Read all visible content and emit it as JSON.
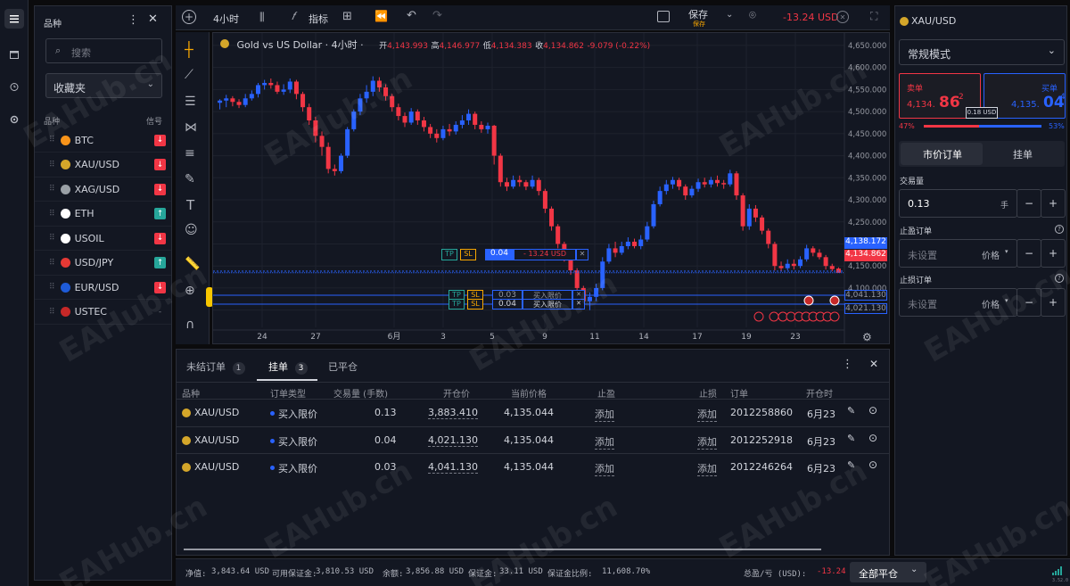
{
  "left_rail": {
    "icons": [
      "list-icon",
      "calendar-icon",
      "alarm-icon",
      "settings-icon"
    ]
  },
  "watchlist": {
    "title": "品种",
    "search_placeholder": "搜索",
    "group": "收藏夹",
    "col_symbol": "品种",
    "col_signal": "信号",
    "items": [
      {
        "name": "BTC",
        "signal": "down",
        "coin_color": "#f7931a"
      },
      {
        "name": "XAU/USD",
        "signal": "down",
        "coin_color": "#d4a62a"
      },
      {
        "name": "XAG/USD",
        "signal": "down",
        "coin_color": "#9aa0a6"
      },
      {
        "name": "ETH",
        "signal": "up",
        "coin_color": "#ffffff"
      },
      {
        "name": "USOIL",
        "signal": "down",
        "coin_color": "#ffffff"
      },
      {
        "name": "USD/JPY",
        "signal": "up",
        "coin_color": "#e53935"
      },
      {
        "name": "EUR/USD",
        "signal": "down",
        "coin_color": "#1e5bd8"
      },
      {
        "name": "USTEC",
        "signal": "none",
        "coin_color": "#c62828"
      }
    ]
  },
  "toolbar": {
    "timeframe": "4小时",
    "indicators": "指标",
    "save": "保存",
    "save_sub": "保存",
    "pnl": "-13.24 USD"
  },
  "chart_header": {
    "symbol": "Gold vs US Dollar · 4小时 ·",
    "open_label": "开",
    "open": "4,143.993",
    "high_label": "高",
    "high": "4,146.977",
    "low_label": "低",
    "low": "4,134.383",
    "close_label": "收",
    "close": "4,134.862",
    "change": "-9.079 (-0.22%)"
  },
  "chart_data": {
    "type": "candlestick",
    "ylim": [
      4021,
      4662
    ],
    "y_ticks": [
      "4,650.000",
      "4,600.000",
      "4,550.000",
      "4,500.000",
      "4,450.000",
      "4,400.000",
      "4,350.000",
      "4,300.000",
      "4,250.000",
      "4,200.000",
      "4,150.000",
      "4,100.000",
      "4,050.000"
    ],
    "x_ticks": [
      "24",
      "27",
      "6月",
      "3",
      "5",
      "9",
      "11",
      "14",
      "17",
      "19",
      "23"
    ],
    "candles": [
      [
        4520,
        4525,
        4512,
        4528,
        4505
      ],
      [
        4525,
        4530,
        4518,
        4538,
        4510
      ],
      [
        4530,
        4522,
        4525,
        4535,
        4512
      ],
      [
        4522,
        4515,
        4520,
        4528,
        4508
      ],
      [
        4515,
        4530,
        4518,
        4540,
        4510
      ],
      [
        4530,
        4540,
        4535,
        4548,
        4525
      ],
      [
        4540,
        4560,
        4555,
        4565,
        4532
      ],
      [
        4560,
        4565,
        4558,
        4572,
        4550
      ],
      [
        4565,
        4560,
        4563,
        4575,
        4552
      ],
      [
        4560,
        4545,
        4550,
        4568,
        4540
      ],
      [
        4545,
        4550,
        4548,
        4562,
        4538
      ],
      [
        4550,
        4568,
        4560,
        4575,
        4542
      ],
      [
        4568,
        4540,
        4545,
        4572,
        4528
      ],
      [
        4540,
        4510,
        4515,
        4545,
        4500
      ],
      [
        4510,
        4480,
        4485,
        4518,
        4470
      ],
      [
        4480,
        4445,
        4450,
        4488,
        4430
      ],
      [
        4445,
        4420,
        4428,
        4455,
        4400
      ],
      [
        4420,
        4370,
        4378,
        4430,
        4360
      ],
      [
        4370,
        4365,
        4368,
        4380,
        4355
      ],
      [
        4365,
        4400,
        4395,
        4405,
        4360
      ],
      [
        4400,
        4460,
        4455,
        4465,
        4395
      ],
      [
        4460,
        4500,
        4495,
        4505,
        4455
      ],
      [
        4500,
        4530,
        4520,
        4540,
        4492
      ],
      [
        4530,
        4545,
        4540,
        4560,
        4520
      ],
      [
        4545,
        4570,
        4565,
        4580,
        4535
      ],
      [
        4570,
        4555,
        4560,
        4578,
        4545
      ],
      [
        4555,
        4535,
        4540,
        4562,
        4525
      ],
      [
        4535,
        4510,
        4515,
        4540,
        4500
      ],
      [
        4510,
        4490,
        4495,
        4518,
        4480
      ],
      [
        4490,
        4475,
        4478,
        4498,
        4465
      ],
      [
        4475,
        4500,
        4495,
        4508,
        4470
      ],
      [
        4500,
        4480,
        4485,
        4505,
        4470
      ],
      [
        4480,
        4465,
        4468,
        4488,
        4455
      ],
      [
        4465,
        4450,
        4455,
        4472,
        4440
      ],
      [
        4450,
        4440,
        4445,
        4460,
        4430
      ],
      [
        4440,
        4460,
        4455,
        4468,
        4435
      ],
      [
        4460,
        4455,
        4458,
        4472,
        4445
      ],
      [
        4455,
        4470,
        4465,
        4478,
        4448
      ],
      [
        4470,
        4480,
        4475,
        4492,
        4462
      ],
      [
        4480,
        4495,
        4490,
        4505,
        4470
      ],
      [
        4495,
        4470,
        4475,
        4500,
        4460
      ],
      [
        4470,
        4460,
        4465,
        4478,
        4452
      ],
      [
        4460,
        4468,
        4463,
        4475,
        4450
      ],
      [
        4468,
        4400,
        4405,
        4470,
        4380
      ],
      [
        4400,
        4340,
        4345,
        4405,
        4330
      ],
      [
        4340,
        4330,
        4335,
        4350,
        4320
      ],
      [
        4330,
        4345,
        4340,
        4355,
        4325
      ],
      [
        4345,
        4340,
        4343,
        4355,
        4330
      ],
      [
        4340,
        4330,
        4335,
        4345,
        4322
      ],
      [
        4330,
        4345,
        4340,
        4355,
        4325
      ],
      [
        4345,
        4320,
        4325,
        4350,
        4310
      ],
      [
        4320,
        4280,
        4285,
        4325,
        4270
      ],
      [
        4280,
        4240,
        4245,
        4285,
        4230
      ],
      [
        4240,
        4200,
        4205,
        4245,
        4190
      ],
      [
        4200,
        4170,
        4175,
        4205,
        4160
      ],
      [
        4170,
        4140,
        4145,
        4175,
        4130
      ],
      [
        4140,
        4100,
        4105,
        4145,
        4090
      ],
      [
        4100,
        4070,
        4075,
        4105,
        4060
      ],
      [
        4070,
        4080,
        4078,
        4090,
        4050
      ],
      [
        4080,
        4100,
        4095,
        4110,
        4070
      ],
      [
        4100,
        4160,
        4150,
        4170,
        4095
      ],
      [
        4160,
        4190,
        4185,
        4200,
        4155
      ],
      [
        4190,
        4180,
        4185,
        4205,
        4170
      ],
      [
        4180,
        4195,
        4190,
        4205,
        4175
      ],
      [
        4195,
        4205,
        4200,
        4215,
        4188
      ],
      [
        4205,
        4195,
        4198,
        4212,
        4190
      ],
      [
        4195,
        4210,
        4205,
        4220,
        4188
      ],
      [
        4210,
        4240,
        4235,
        4250,
        4205
      ],
      [
        4240,
        4290,
        4285,
        4298,
        4235
      ],
      [
        4290,
        4320,
        4315,
        4330,
        4285
      ],
      [
        4320,
        4335,
        4330,
        4345,
        4312
      ],
      [
        4335,
        4345,
        4340,
        4352,
        4325
      ],
      [
        4345,
        4330,
        4335,
        4350,
        4322
      ],
      [
        4330,
        4310,
        4315,
        4335,
        4300
      ],
      [
        4310,
        4325,
        4320,
        4332,
        4305
      ],
      [
        4325,
        4340,
        4335,
        4348,
        4318
      ],
      [
        4340,
        4335,
        4338,
        4350,
        4328
      ],
      [
        4335,
        4345,
        4340,
        4352,
        4328
      ],
      [
        4345,
        4338,
        4342,
        4355,
        4330
      ],
      [
        4338,
        4335,
        4337,
        4345,
        4325
      ],
      [
        4335,
        4360,
        4355,
        4368,
        4330
      ],
      [
        4360,
        4310,
        4315,
        4365,
        4300
      ],
      [
        4310,
        4240,
        4245,
        4315,
        4230
      ],
      [
        4240,
        4280,
        4275,
        4290,
        4232
      ],
      [
        4280,
        4260,
        4265,
        4288,
        4250
      ],
      [
        4260,
        4230,
        4235,
        4265,
        4222
      ],
      [
        4230,
        4200,
        4205,
        4235,
        4190
      ],
      [
        4200,
        4150,
        4155,
        4205,
        4140
      ],
      [
        4150,
        4145,
        4148,
        4160,
        4138
      ],
      [
        4145,
        4155,
        4150,
        4165,
        4140
      ],
      [
        4155,
        4150,
        4152,
        4165,
        4142
      ],
      [
        4150,
        4165,
        4160,
        4172,
        4145
      ],
      [
        4165,
        4190,
        4185,
        4198,
        4160
      ],
      [
        4190,
        4180,
        4185,
        4195,
        4172
      ],
      [
        4180,
        4170,
        4175,
        4188,
        4165
      ],
      [
        4170,
        4150,
        4155,
        4175,
        4142
      ],
      [
        4150,
        4143,
        4146,
        4155,
        4138
      ],
      [
        4143.993,
        4134.862,
        4140,
        4146.977,
        4134.383
      ]
    ],
    "bid": 4134.862,
    "ask": 4138.172
  },
  "chart_labels": {
    "price_bid": "4,134.862",
    "price_ask": "4,138.172",
    "tp": "TP",
    "sl": "SL",
    "pos_qty": "0.04",
    "pos_pnl": "- 13.24 USD",
    "ord1_qty": "0.03",
    "ord1_label": "买入限价",
    "ord2_qty": "0.04",
    "ord2_label": "买入限价",
    "ord1_price": "4,041.130",
    "ord2_price": "4,021.130"
  },
  "bottom": {
    "tabs": [
      {
        "label": "未结订单",
        "count": "1"
      },
      {
        "label": "挂单",
        "count": "3"
      },
      {
        "label": "已平仓",
        "count": ""
      }
    ],
    "columns": [
      "品种",
      "订单类型",
      "交易量 (手数)",
      "开仓价",
      "当前价格",
      "止盈",
      "止损",
      "订单",
      "开仓时"
    ],
    "rows": [
      {
        "symbol": "XAU/USD",
        "type": "买入限价",
        "volume": "0.13",
        "open": "3,883.410",
        "current": "4,135.044",
        "tp": "添加",
        "sl": "添加",
        "order": "2012258860",
        "time": "6月23"
      },
      {
        "symbol": "XAU/USD",
        "type": "买入限价",
        "volume": "0.04",
        "open": "4,021.130",
        "current": "4,135.044",
        "tp": "添加",
        "sl": "添加",
        "order": "2012252918",
        "time": "6月23"
      },
      {
        "symbol": "XAU/USD",
        "type": "买入限价",
        "volume": "0.03",
        "open": "4,041.130",
        "current": "4,135.044",
        "tp": "添加",
        "sl": "添加",
        "order": "2012246264",
        "time": "6月23"
      }
    ]
  },
  "status_bar": {
    "equity_label": "净值:",
    "equity": "3,843.64 USD",
    "free_margin_label": "可用保证金:",
    "free_margin": "3,810.53 USD",
    "balance_label": "余额:",
    "balance": "3,856.88 USD",
    "margin_label": "保证金:",
    "margin": "33.11 USD",
    "margin_level_label": "保证金比例:",
    "margin_level": "11,608.70%",
    "pnl_label": "总盈/亏 (USD):",
    "pnl": "-13.24",
    "close_all": "全部平仓",
    "version": "3.52.0"
  },
  "order_panel": {
    "symbol": "XAU/USD",
    "mode": "常规模式",
    "sell_label": "卖单",
    "sell_price_main": "4,134.",
    "sell_price_big": "86",
    "sell_price_sup": "2",
    "buy_label": "买单",
    "buy_price_main": "4,135.",
    "buy_price_big": "04",
    "buy_price_sup": "4",
    "spread": "0.18 USD",
    "sell_pct": "47%",
    "buy_pct": "53%",
    "sell_fraction": 0.47,
    "tab_market": "市价订单",
    "tab_pending": "挂单",
    "volume_label": "交易量",
    "volume": "0.13",
    "volume_unit": "手",
    "tp_label": "止盈订单",
    "tp_placeholder": "未设置",
    "tp_unit": "价格",
    "sl_label": "止损订单",
    "sl_placeholder": "未设置",
    "sl_unit": "价格"
  },
  "watermark": "EAHub.cn",
  "colors": {
    "up": "#2962ff",
    "down": "#f23645",
    "bg": "#131722",
    "accent": "#2962ff"
  }
}
